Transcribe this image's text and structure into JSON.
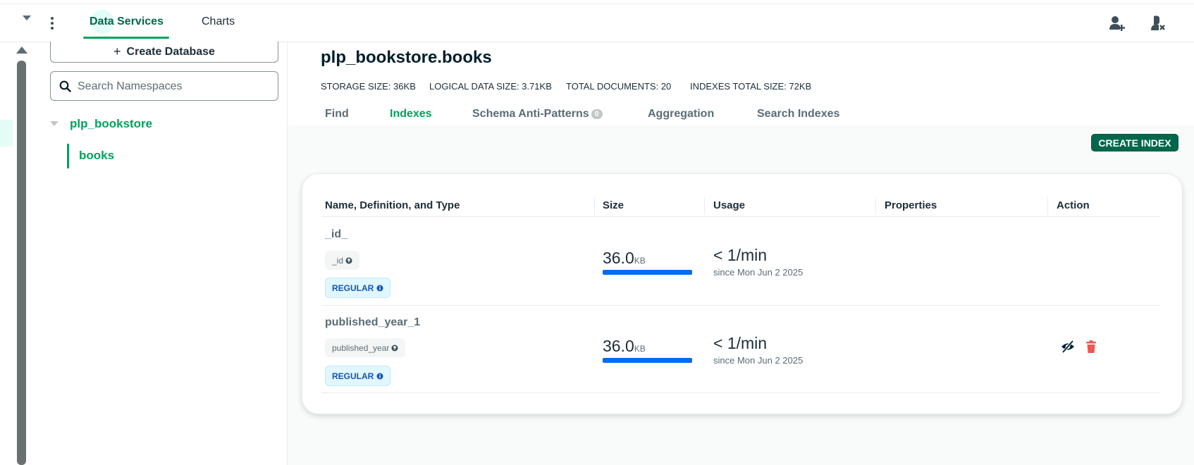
{
  "topbar": {
    "tabs": [
      {
        "label": "Data Services",
        "active": true
      },
      {
        "label": "Charts",
        "active": false
      }
    ],
    "icons": [
      "caret-down-icon",
      "more-vertical-icon",
      "invite-user-icon",
      "settings-user-icon"
    ]
  },
  "sidebar": {
    "create_db_label": "Create Database",
    "search_placeholder": "Search Namespaces",
    "database": "plp_bookstore",
    "collection": "books"
  },
  "main": {
    "title": "plp_bookstore.books",
    "stats": {
      "storage": "STORAGE SIZE: 36KB",
      "logical": "LOGICAL DATA SIZE: 3.71KB",
      "docs": "TOTAL DOCUMENTS: 20",
      "indexes": "INDEXES TOTAL SIZE: 72KB"
    },
    "tabs": [
      {
        "label": "Find"
      },
      {
        "label": "Indexes",
        "active": true
      },
      {
        "label": "Schema Anti-Patterns",
        "badge": "0"
      },
      {
        "label": "Aggregation"
      },
      {
        "label": "Search Indexes"
      }
    ],
    "create_index_label": "CREATE INDEX"
  },
  "table": {
    "headers": [
      "Name, Definition, and Type",
      "Size",
      "Usage",
      "Properties",
      "Action"
    ],
    "rows": [
      {
        "name": "_id_",
        "field": "_id",
        "type": "REGULAR",
        "size_value": "36.0",
        "size_unit": "KB",
        "size_fraction": 1.0,
        "usage": "< 1/min",
        "since": "since Mon Jun 2 2025",
        "actions": []
      },
      {
        "name": "published_year_1",
        "field": "published_year",
        "type": "REGULAR",
        "size_value": "36.0",
        "size_unit": "KB",
        "size_fraction": 1.0,
        "usage": "< 1/min",
        "since": "since Mon Jun 2 2025",
        "actions": [
          "hide-index-icon",
          "delete-index-icon"
        ]
      }
    ]
  },
  "colors": {
    "brand_green": "#00a35c",
    "dark_green": "#00684a",
    "usage_blue": "#016bf8",
    "delete_red": "#ef5752"
  }
}
